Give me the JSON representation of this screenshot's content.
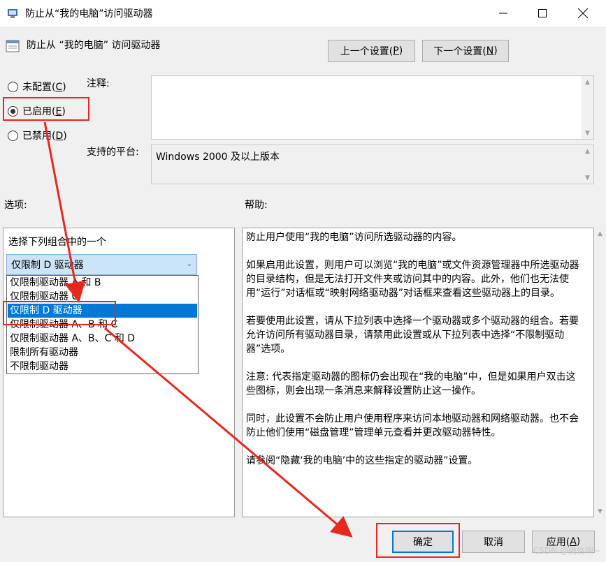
{
  "window": {
    "title": "防止从“我的电脑”访问驱动器",
    "minimize_icon": "minimize-icon",
    "maximize_icon": "maximize-icon",
    "close_icon": "close-icon"
  },
  "header": {
    "policy_title": "防止从 “我的电脑” 访问驱动器",
    "prev_setting": "上一个设置(",
    "prev_key": "P",
    "next_setting": "下一个设置(",
    "next_key": "N"
  },
  "radios": [
    {
      "label": "未配置(",
      "key": "C",
      "checked": false
    },
    {
      "label": "已启用(",
      "key": "E",
      "checked": true
    },
    {
      "label": "已禁用(",
      "key": "D",
      "checked": false
    }
  ],
  "comment": {
    "label": "注释:",
    "value": ""
  },
  "platform": {
    "label": "支持的平台:",
    "value": "Windows 2000 及以上版本"
  },
  "options": {
    "label": "选项:",
    "prompt": "选择下列组合中的一个",
    "selected": "仅限制 D 驱动器",
    "items": [
      "仅限制驱动器 A 和 B",
      "仅限制驱动器 C",
      "仅限制 D 驱动器",
      "仅限制驱动器 A、B 和 C",
      "仅限制驱动器 A、B、C 和 D",
      "限制所有驱动器",
      "不限制驱动器"
    ],
    "selected_index": 2
  },
  "help": {
    "label": "帮助:",
    "paragraphs": [
      "防止用户使用“我的电脑”访问所选驱动器的内容。",
      "如果启用此设置，则用户可以浏览“我的电脑”或文件资源管理器中所选驱动器的目录结构，但是无法打开文件夹或访问其中的内容。此外，他们也无法使用“运行”对话框或“映射网络驱动器”对话框来查看这些驱动器上的目录。",
      "若要使用此设置，请从下拉列表中选择一个驱动器或多个驱动器的组合。若要允许访问所有驱动器目录，请禁用此设置或从下拉列表中选择“不限制驱动器”选项。",
      "注意: 代表指定驱动器的图标仍会出现在“我的电脑”中，但是如果用户双击这些图标，则会出现一条消息来解释设置防止这一操作。",
      " 同时，此设置不会防止用户使用程序来访问本地驱动器和网络驱动器。也不会防止他们使用“磁盘管理”管理单元查看并更改驱动器特性。",
      "请参阅“隐藏‘我的电脑’中的这些指定的驱动器”设置。"
    ]
  },
  "footer": {
    "ok": "确定",
    "cancel": "取消",
    "apply": "应用(",
    "apply_key": "A"
  },
  "watermark": "CSDN @微信啊~",
  "colors": {
    "annotation": "#e8281f",
    "selection": "#0078d7"
  }
}
